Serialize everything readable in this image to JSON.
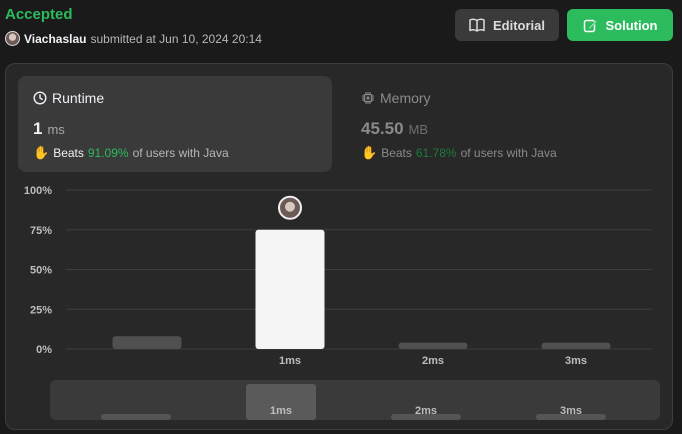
{
  "status": {
    "title": "Accepted",
    "user": "Viachaslau",
    "meta": "submitted at Jun 10, 2024 20:14"
  },
  "buttons": {
    "editorial": "Editorial",
    "solution": "Solution"
  },
  "colors": {
    "accent": "#2cbb5d",
    "selected_bar": "#f5f5f5",
    "other_bar": "#505050"
  },
  "runtime": {
    "label": "Runtime",
    "value": "1",
    "unit": "ms",
    "beats_prefix": "Beats",
    "beats_pct": "91.09%",
    "beats_suffix": "of users with Java",
    "icon": "clock-icon"
  },
  "memory": {
    "label": "Memory",
    "value": "45.50",
    "unit": "MB",
    "beats_prefix": "Beats",
    "beats_pct": "61.78%",
    "beats_suffix": "of users with Java",
    "icon": "chip-icon"
  },
  "chart_data": {
    "type": "bar",
    "categories": [
      "",
      "1ms",
      "2ms",
      "3ms"
    ],
    "values": [
      8,
      75,
      4,
      4
    ],
    "selected_index": 1,
    "yticks": [
      "100%",
      "75%",
      "50%",
      "25%",
      "0%"
    ],
    "ylim": [
      0,
      100
    ],
    "grid": true,
    "overview_categories": [
      "",
      "1ms",
      "2ms",
      "3ms"
    ]
  }
}
